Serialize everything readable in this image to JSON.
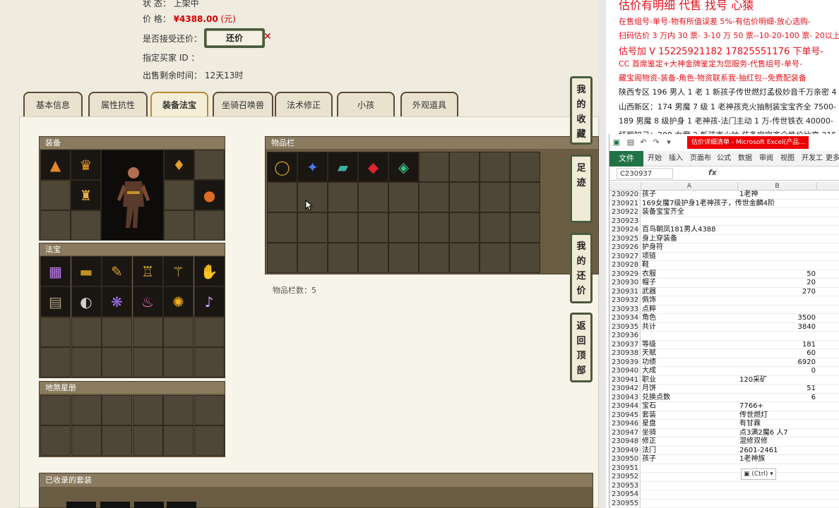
{
  "listing": {
    "status_label": "状    态：",
    "status_value": "上架中",
    "price_label": "价      格：",
    "price_value": "¥4388.00",
    "price_unit": "(元)",
    "counter_label": "是否接受还价：",
    "counter_button": "还价",
    "buyer_label": "指定买家 ID ：",
    "time_label": "出售剩余时间：",
    "time_value": "12天13时"
  },
  "tabs": [
    "基本信息",
    "属性抗性",
    "装备法宝",
    "坐骑召唤兽",
    "法术修正",
    "小孩",
    "外观道具"
  ],
  "active_tab": 2,
  "sections": {
    "equipment": "装备",
    "inventory": "物品栏",
    "treasure": "法宝",
    "earth_star": "地煞星册",
    "suits": "已收录的套装",
    "inventory_count": "物品栏数：5"
  },
  "side_buttons": {
    "favorites": "我的收藏",
    "footprint": "足迹",
    "my_offers": "我的还价",
    "back_top": "返回顶部"
  },
  "ad": {
    "headline": "估价有明细 代售 找号 心猿",
    "lines": [
      "在售组号-单号-物有所值误差 5%-有估价明细-放心选购-",
      "扫码估价 3 万内 30 票- 3-10 万 50 票--10-20-100 票- 20以上 150-",
      "估号加 V 15225921182 17825551176 下单号-",
      "CC 首席鉴定+大神金牌鉴定为您服务-代售组号-单号-",
      "藏宝阁物资-装备-角色-物资联系我-抽红包--免费配装备",
      "陕西专区 196 男人 1 老 1 新孩子传世燃灯孟极妙音千万亲密 4",
      "山西新区：174 男魔 7 级 1 老神孩克火抽制装宝宝齐全 7500-",
      "189 男魔 8 级护身 1 老神孩-法门主动 1 万-传世铁衣 40000-",
      "红颜知己：200 女魔 2 新孩克火抽 装备宝宝齐全性价比高 215"
    ]
  },
  "excel": {
    "title": "估价详细清单 - Microsoft Excel(产品...",
    "file_tab": "文件",
    "ribbon_tabs": [
      "开始",
      "插入",
      "页面布",
      "公式",
      "数据",
      "审阅",
      "视图",
      "开发工",
      "更多"
    ],
    "name_box": "C230937",
    "fx": "fx",
    "col_a": "A",
    "col_b": "B",
    "paste_hint": "(Ctrl)",
    "rows": [
      {
        "n": "230920",
        "a": "孩子",
        "b": "1老神"
      },
      {
        "n": "230921",
        "a": "169女魔7级护身1老神孩子，传世金麟4阶",
        "b": ""
      },
      {
        "n": "230922",
        "a": "装备宝宝齐全",
        "b": ""
      },
      {
        "n": "230923",
        "a": "",
        "b": ""
      },
      {
        "n": "230924",
        "a": "百鸟朝凤181男人4388",
        "b": ""
      },
      {
        "n": "230925",
        "a": "身上穿装备",
        "b": ""
      },
      {
        "n": "230926",
        "a": "护身符",
        "b": ""
      },
      {
        "n": "230927",
        "a": "项链",
        "b": ""
      },
      {
        "n": "230928",
        "a": "鞋",
        "b": ""
      },
      {
        "n": "230929",
        "a": "衣服",
        "b": "50"
      },
      {
        "n": "230930",
        "a": "帽子",
        "b": "20"
      },
      {
        "n": "230931",
        "a": "武器",
        "b": "270"
      },
      {
        "n": "230932",
        "a": "佩饰",
        "b": ""
      },
      {
        "n": "230933",
        "a": "点粹",
        "b": ""
      },
      {
        "n": "230934",
        "a": "角色",
        "b": "3500"
      },
      {
        "n": "230935",
        "a": "共计",
        "b": "3840"
      },
      {
        "n": "230936",
        "a": "",
        "b": ""
      },
      {
        "n": "230937",
        "a": "等级",
        "b": "181"
      },
      {
        "n": "230938",
        "a": "天赋",
        "b": "60"
      },
      {
        "n": "230939",
        "a": "功绩",
        "b": "6920"
      },
      {
        "n": "230940",
        "a": "大成",
        "b": "0"
      },
      {
        "n": "230941",
        "a": "职业",
        "b": "120采矿"
      },
      {
        "n": "230942",
        "a": "月饼",
        "b": "51"
      },
      {
        "n": "230943",
        "a": "兑换点数",
        "b": "6"
      },
      {
        "n": "230944",
        "a": "宝石",
        "b": "7766+"
      },
      {
        "n": "230945",
        "a": "套装",
        "b": "传世燃灯"
      },
      {
        "n": "230946",
        "a": "星盘",
        "b": "有甘霖"
      },
      {
        "n": "230947",
        "a": "坐骑",
        "b": "点3满2魔6 人7"
      },
      {
        "n": "230948",
        "a": "修正",
        "b": "混修双修"
      },
      {
        "n": "230949",
        "a": "法门",
        "b": "2601-2461"
      },
      {
        "n": "230950",
        "a": "孩子",
        "b": "1老神族"
      },
      {
        "n": "230951",
        "a": "",
        "b": ""
      },
      {
        "n": "230952",
        "a": "",
        "b": ""
      },
      {
        "n": "230953",
        "a": "",
        "b": ""
      },
      {
        "n": "230954",
        "a": "",
        "b": ""
      },
      {
        "n": "230955",
        "a": "",
        "b": ""
      }
    ]
  },
  "icons": {
    "equipment": [
      "hat-icon",
      "helmet-icon",
      "amulet-icon",
      "robe-icon",
      "necklace-icon",
      "boots-icon"
    ],
    "inventory": [
      "ring-icon",
      "orb-icon",
      "scroll-icon",
      "ruby-icon",
      "jade-icon"
    ],
    "treasure": [
      "box-icon",
      "plate-icon",
      "staff-icon",
      "tower-icon",
      "scepter-icon",
      "claw-icon",
      "book-icon",
      "mirror-icon",
      "fan-icon",
      "lantern-icon",
      "flame-icon",
      "bell-icon"
    ]
  }
}
